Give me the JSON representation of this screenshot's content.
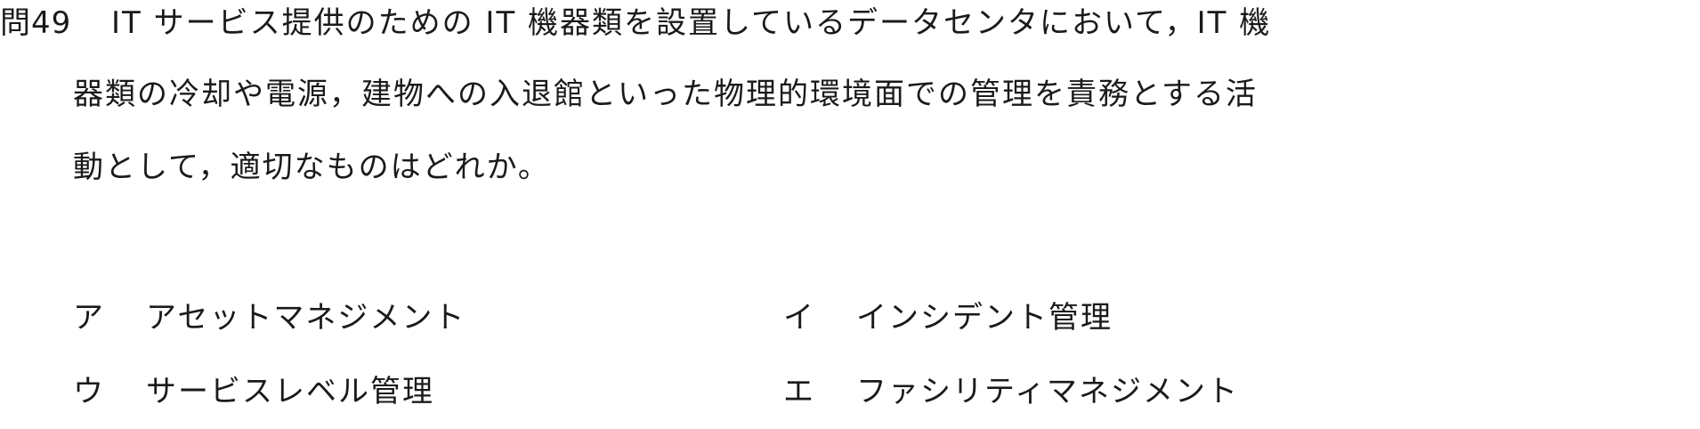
{
  "question": {
    "number": "問49",
    "lines": [
      "IT サービス提供のための IT 機器類を設置しているデータセンタにおいて，IT 機",
      "器類の冷却や電源，建物への入退館といった物理的環境面での管理を責務とする活",
      "動として，適切なものはどれか。"
    ]
  },
  "choices": [
    {
      "mark": "ア",
      "text": "アセットマネジメント"
    },
    {
      "mark": "イ",
      "text": "インシデント管理"
    },
    {
      "mark": "ウ",
      "text": "サービスレベル管理"
    },
    {
      "mark": "エ",
      "text": "ファシリティマネジメント"
    }
  ]
}
